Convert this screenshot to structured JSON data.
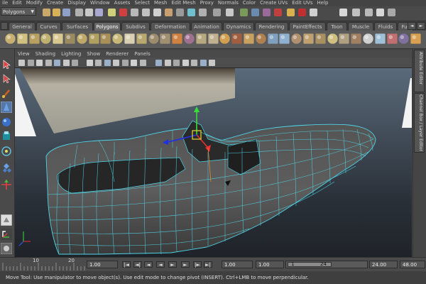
{
  "menubar": [
    "ile",
    "Edit",
    "Modify",
    "Create",
    "Display",
    "Window",
    "Assets",
    "Select",
    "Mesh",
    "Edit Mesh",
    "Proxy",
    "Normals",
    "Color",
    "Create UVs",
    "Edit UVs",
    "Help"
  ],
  "statusline": {
    "mode": "Polygons"
  },
  "shelf": {
    "tabs": [
      "General",
      "Curves",
      "Surfaces",
      "Polygons",
      "Subdivs",
      "Deformation",
      "Animation",
      "Dynamics",
      "Rendering",
      "PaintEffects",
      "Toon",
      "Muscle",
      "Fluids",
      "Fur"
    ],
    "active": "Polygons"
  },
  "panel": {
    "menus": [
      "View",
      "Shading",
      "Lighting",
      "Show",
      "Renderer",
      "Panels"
    ]
  },
  "right_tabs": [
    "Attribute Editor",
    "Channel Box / Layer Editor"
  ],
  "timeslider": {
    "ticks": [
      "10",
      "20"
    ],
    "current_time": "1.00",
    "range_start": "1.00",
    "anim_start": "1.00",
    "range_left": "1",
    "range_right": "24",
    "range_end": "24.00",
    "anim_end": "48.00"
  },
  "playback": [
    "|◄",
    "◄|",
    "◄",
    "▶",
    "►|",
    "►|"
  ],
  "helpline": "Move Tool: Use manipulator to move object(s). Use edit mode to change pivot (INSERT). Ctrl+LMB to move perpendicular.",
  "colors": {
    "wire": "#4fd4e6",
    "bg_top": "#5a6a7a",
    "bg_bottom": "#1f2329",
    "accent": "#d8c038"
  }
}
